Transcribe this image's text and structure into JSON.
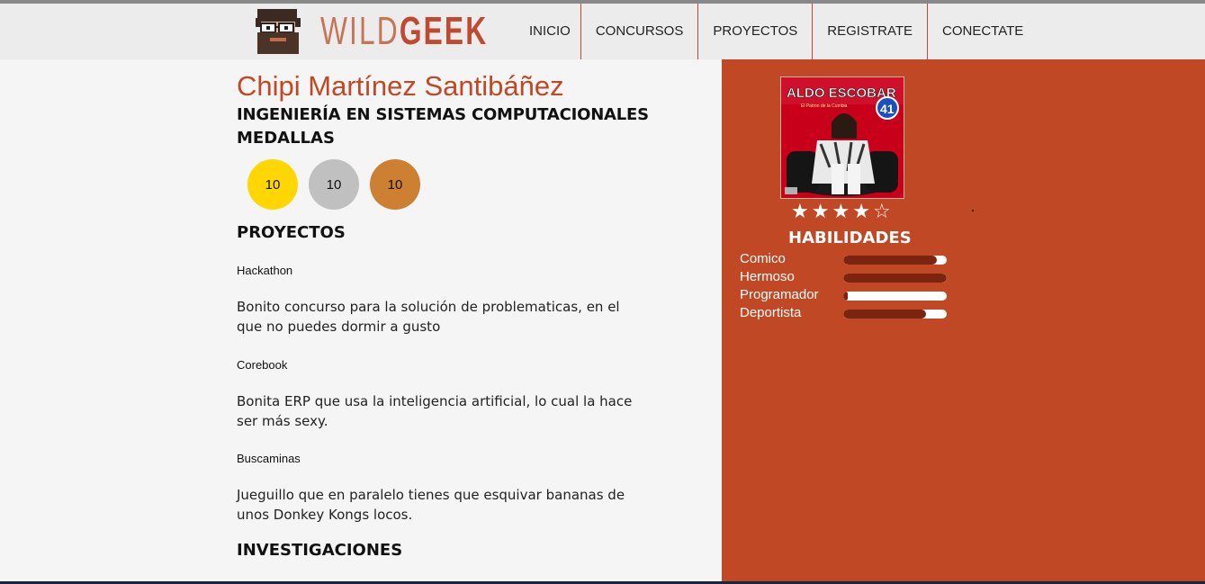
{
  "header": {
    "logo_wild": "WILD",
    "logo_geek": "GEEK",
    "nav": [
      "INICIO",
      "CONCURSOS",
      "PROYECTOS",
      "REGISTRATE",
      "CONECTATE"
    ]
  },
  "profile": {
    "name": "Chipi Martínez Santibáñez",
    "career": "INGENIERÍA EN SISTEMAS COMPUTACIONALES",
    "medals_heading": "MEDALLAS",
    "medals": [
      {
        "value": "10",
        "color": "#ffd700"
      },
      {
        "value": "10",
        "color": "#c0c0c0"
      },
      {
        "value": "10",
        "color": "#cd7f32"
      }
    ]
  },
  "projects": {
    "heading": "PROYECTOS",
    "items": [
      {
        "title": "Hackathon",
        "desc": "Bonito concurso para la solución de problematicas, en el que no puedes dormir a gusto"
      },
      {
        "title": "Corebook",
        "desc": "Bonita ERP que usa la inteligencia artificial, lo cual la hace ser más sexy."
      },
      {
        "title": "Buscaminas",
        "desc": "Jueguillo que en paralelo tienes que esquivar bananas de unos Donkey Kongs locos."
      }
    ]
  },
  "research": {
    "heading": "INVESTIGACIONES"
  },
  "sidebar": {
    "album": {
      "title": "ALDO ESCOBAR",
      "subtitle": "El Patron de la Cumbia",
      "number": "41"
    },
    "rating": {
      "value": 4,
      "max": 5
    },
    "skills_heading": "HABILIDADES",
    "skills": [
      {
        "name": "Comico",
        "level": 0.9
      },
      {
        "name": "Hermoso",
        "level": 1.0
      },
      {
        "name": "Programador",
        "level": 0.04
      },
      {
        "name": "Deportista",
        "level": 0.8
      }
    ]
  },
  "colors": {
    "accent": "#c14824",
    "bar_fill": "#7b2410"
  }
}
